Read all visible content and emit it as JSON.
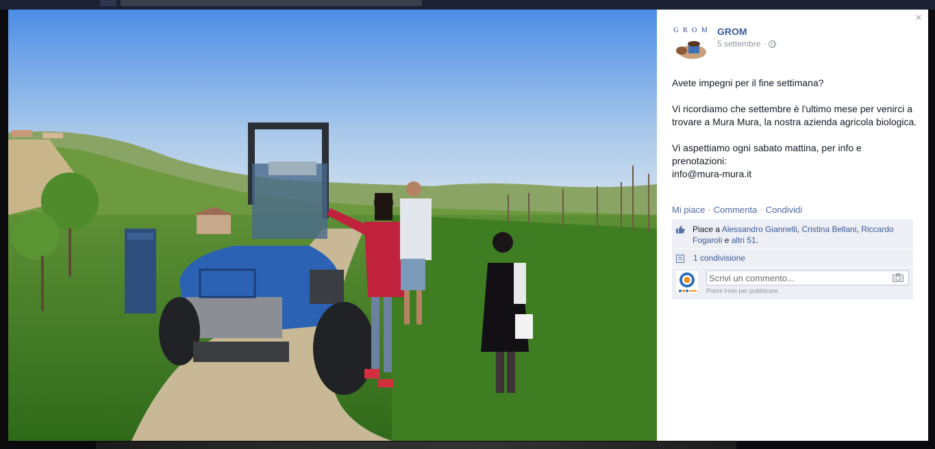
{
  "post": {
    "page_name": "GROM",
    "date": "5 settembre",
    "separator": "·",
    "paragraphs": [
      "Avete impegni per il fine settimana?",
      "Vi ricordiamo che settembre è l'ultimo mese per venirci a trovare a Mura Mura, la nostra azienda agricola biologica.",
      "Vi aspettiamo ogni sabato mattina, per info e prenotazioni:\ninfo@mura-mura.it"
    ],
    "avatar_logo_text": "G R O M",
    "audience_icon": "globe-icon"
  },
  "actions": {
    "like": "Mi piace",
    "comment": "Commenta",
    "share": "Condividi",
    "sep": "·"
  },
  "likes": {
    "prefix": "Piace a",
    "people": [
      "Alessandro Giannelli",
      "Cristina Bellani",
      "Riccardo Fogaroli"
    ],
    "comma": ",",
    "conjunction": "e",
    "others": "altri 51",
    "suffix": "."
  },
  "shares": {
    "label": "1 condivisione"
  },
  "comment_box": {
    "placeholder": "Scrivi un commento...",
    "hint": "Premi Invio per pubblicare."
  },
  "close_label": "×",
  "colors": {
    "link": "#3b5998",
    "ufi_bg": "#edeff4",
    "meta": "#90949c"
  }
}
